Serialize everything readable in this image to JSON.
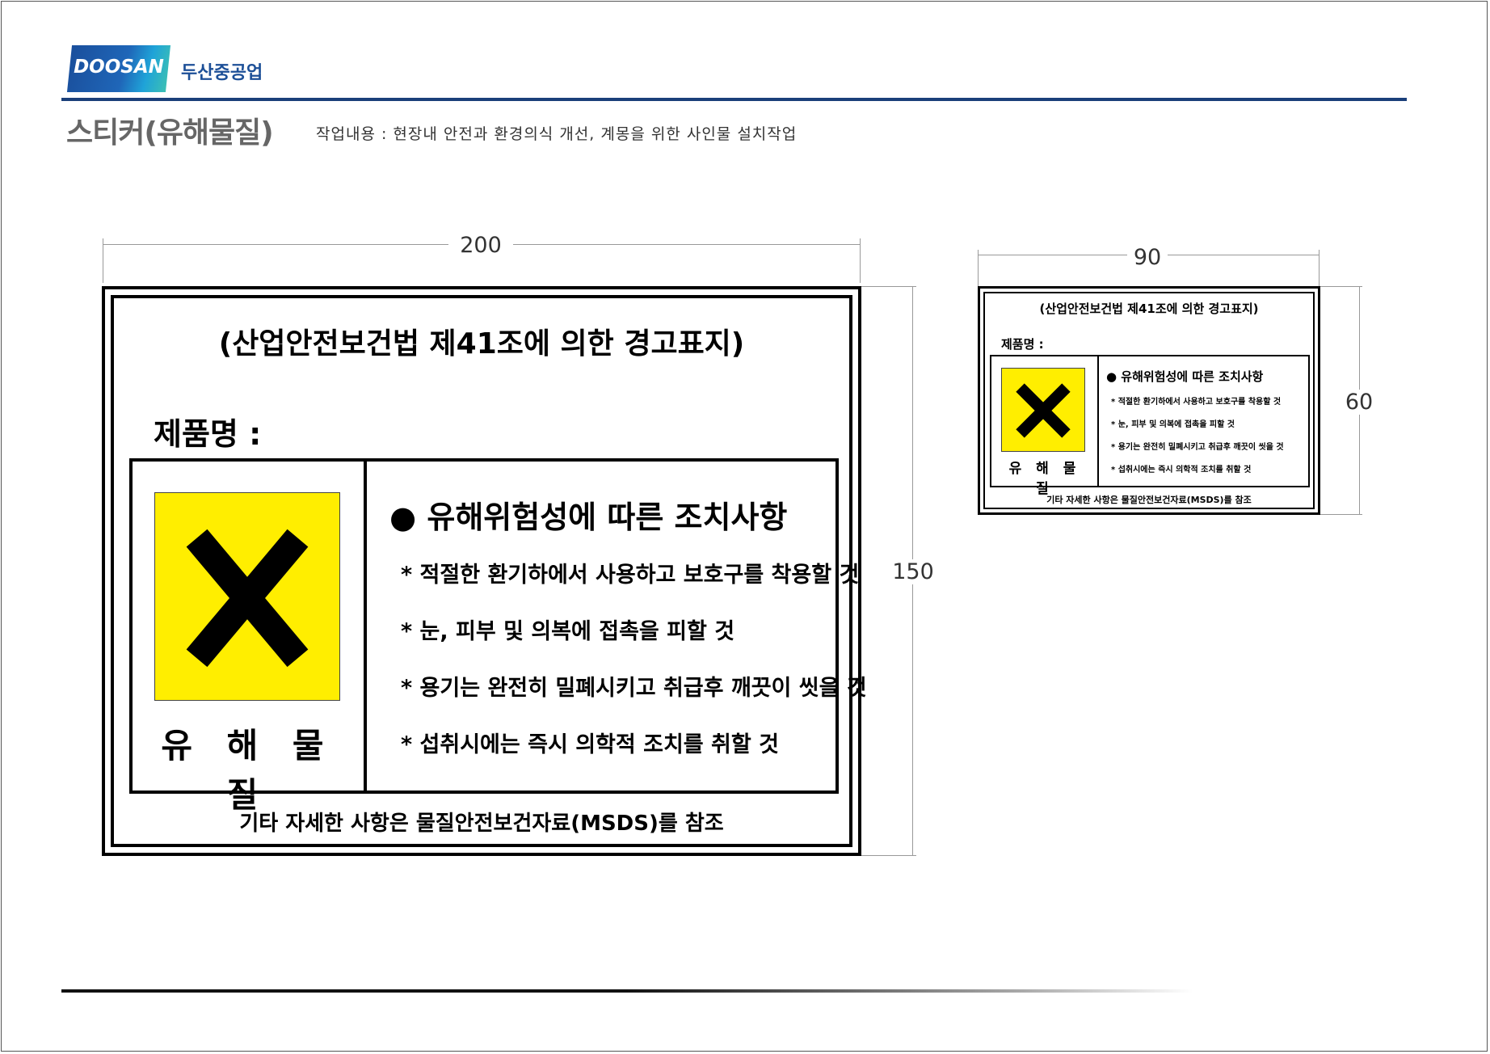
{
  "header": {
    "logo_text": "DOOSAN",
    "company": "두산중공업",
    "title": "스티커(유해물질)",
    "work_desc": "작업내용 : 현장내 안전과 환경의식 개선, 계몽을 위한 사인물 설치작업"
  },
  "colors": {
    "brand": "#1c4f97",
    "hazard_yellow": "#ffee00"
  },
  "dimensions": {
    "large_width": "200",
    "large_height": "150",
    "small_width": "90",
    "small_height": "60"
  },
  "sticker": {
    "title": "(산업안전보건법 제41조에 의한 경고표지)",
    "product_label": "제품명 :",
    "hazard_icon": "x-cross-icon",
    "hazard_label": "유 해 물 질",
    "measures_heading": "● 유해위험성에 따른 조치사항",
    "measures": [
      "* 적절한 환기하에서 사용하고 보호구를 착용할 것",
      "* 눈, 피부 및 의복에 접촉을 피할 것",
      "* 용기는 완전히 밀폐시키고 취급후 깨끗이 씻을 것",
      "* 섭취시에는 즉시 의학적 조치를 취할 것"
    ],
    "footer": "기타 자세한 사항은 물질안전보건자료(MSDS)를 참조"
  }
}
